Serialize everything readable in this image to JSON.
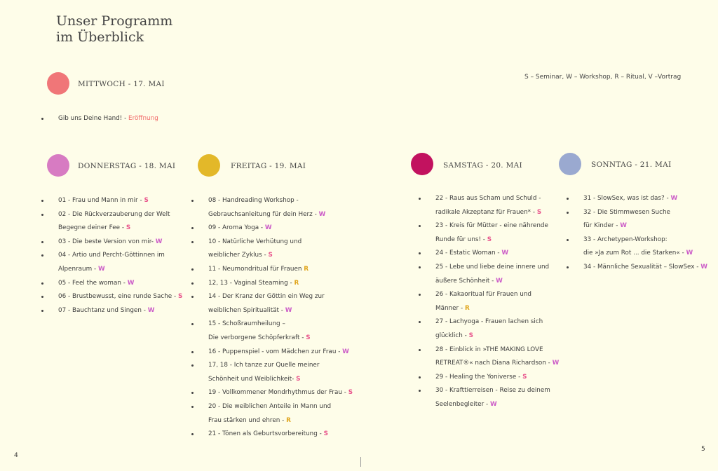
{
  "title": {
    "line1": "Unser Programm",
    "line2": "im Überblick"
  },
  "legend": "S – Seminar, W – Workshop, R – Ritual, V –Vortrag",
  "colors": {
    "S": "#e8518a",
    "W": "#cc5cc8",
    "R": "#e0a51d",
    "Eroeffnung": "#f26b6b"
  },
  "days": [
    {
      "label": "MITTWOCH - 17. MAI",
      "color": "#f07678"
    },
    {
      "label": "DONNERSTAG - 18. MAI",
      "color": "#d77bc2"
    },
    {
      "label": "FREITAG - 19. MAI",
      "color": "#e3b829"
    },
    {
      "label": "SAMSTAG - 20. MAI",
      "color": "#c2125f"
    },
    {
      "label": "SONNTAG - 21. MAI",
      "color": "#9aa9d0"
    }
  ],
  "mittwoch": [
    {
      "lines": [
        {
          "t": "Gib uns Deine Hand! - ",
          "c": "Eröffnung"
        }
      ]
    }
  ],
  "donnerstag": [
    {
      "lines": [
        {
          "t": "01 - Frau und Mann in mir - ",
          "c": "S"
        }
      ]
    },
    {
      "lines": [
        {
          "t": "02 - Die Rückverzauberung der Welt"
        },
        {
          "t": "Begegne deiner Fee - ",
          "c": "S"
        }
      ]
    },
    {
      "lines": [
        {
          "t": "03 - Die beste Version von mir- ",
          "c": "W"
        }
      ]
    },
    {
      "lines": [
        {
          "t": "04 - Artio und Percht-Göttinnen im"
        },
        {
          "t": "Alpenraum - ",
          "c": "W"
        }
      ]
    },
    {
      "lines": [
        {
          "t": "05 - Feel the woman - ",
          "c": "W"
        }
      ]
    },
    {
      "lines": [
        {
          "t": "06 - Brustbewusst, eine runde Sache - ",
          "c": "S"
        }
      ]
    },
    {
      "lines": [
        {
          "t": "07 - Bauchtanz und Singen - ",
          "c": "W"
        }
      ]
    }
  ],
  "freitag": [
    {
      "lines": [
        {
          "t": "08 - Handreading Workshop -"
        },
        {
          "t": "Gebrauchsanleitung für dein Herz - ",
          "c": "W"
        }
      ]
    },
    {
      "lines": [
        {
          "t": "09 - Aroma Yoga - ",
          "c": "W"
        }
      ]
    },
    {
      "lines": [
        {
          "t": "10 - Natürliche Verhütung und"
        },
        {
          "t": "weiblicher Zyklus - ",
          "c": "S"
        }
      ]
    },
    {
      "lines": [
        {
          "t": "11 - Neumondritual für Frauen ",
          "c": "R"
        }
      ]
    },
    {
      "lines": [
        {
          "t": "12, 13 - Vaginal Steaming - ",
          "c": "R"
        }
      ]
    },
    {
      "lines": [
        {
          "t": "14 - Der Kranz der Göttin ein Weg zur"
        },
        {
          "t": "weiblichen Spiritualität - ",
          "c": "W"
        }
      ]
    },
    {
      "lines": [
        {
          "t": "15 - Schoßraumheilung –"
        },
        {
          "t": "Die verborgene Schöpferkraft - ",
          "c": "S"
        }
      ]
    },
    {
      "lines": [
        {
          "t": "16 - Puppenspiel - vom Mädchen zur Frau - ",
          "c": "W"
        }
      ]
    },
    {
      "lines": [
        {
          "t": "17, 18 - Ich tanze zur Quelle meiner"
        },
        {
          "t": "Schönheit und Weiblichkeit- ",
          "c": "S"
        }
      ]
    },
    {
      "lines": [
        {
          "t": "19 - Vollkommener Mondrhythmus der Frau - ",
          "c": "S"
        }
      ]
    },
    {
      "lines": [
        {
          "t": "20 - Die weiblichen Anteile in Mann und"
        },
        {
          "t": "Frau stärken und ehren - ",
          "c": "R"
        }
      ]
    },
    {
      "lines": [
        {
          "t": "21 - Tönen als Geburtsvorbereitung - ",
          "c": "S"
        }
      ]
    }
  ],
  "samstag": [
    {
      "lines": [
        {
          "t": "22 - Raus aus Scham und Schuld -"
        },
        {
          "t": "radikale Akzeptanz für Frauen* - ",
          "c": "S"
        }
      ]
    },
    {
      "lines": [
        {
          "t": "23 - Kreis für Mütter - eine nährende"
        },
        {
          "t": "Runde für uns! - ",
          "c": "S"
        }
      ]
    },
    {
      "lines": [
        {
          "t": "24 - Estatic Woman - ",
          "c": "W"
        }
      ]
    },
    {
      "lines": [
        {
          "t": "25 - Lebe und liebe deine innere und"
        },
        {
          "t": "äußere Schönheit - ",
          "c": "W"
        }
      ]
    },
    {
      "lines": [
        {
          "t": "26 - Kakaoritual für Frauen und"
        },
        {
          "t": "Männer - ",
          "c": "R"
        }
      ]
    },
    {
      "lines": [
        {
          "t": "27 - Lachyoga - Frauen lachen sich"
        },
        {
          "t": "glücklich - ",
          "c": "S"
        }
      ]
    },
    {
      "lines": [
        {
          "t": "28 - Einblick in »THE MAKING LOVE"
        },
        {
          "t": "RETREAT®« nach Diana Richardson - ",
          "c": "W"
        }
      ]
    },
    {
      "lines": [
        {
          "t": "29 - Healing the Yoniverse - ",
          "c": "S"
        }
      ]
    },
    {
      "lines": [
        {
          "t": "30 - Krafttierreisen - Reise zu deinem"
        },
        {
          "t": "Seelenbegleiter - ",
          "c": "W"
        }
      ]
    }
  ],
  "sonntag": [
    {
      "lines": [
        {
          "t": "31 - SlowSex, was ist das? - ",
          "c": "W"
        }
      ]
    },
    {
      "lines": [
        {
          "t": "32 - Die Stimmwesen Suche"
        },
        {
          "t": "für Kinder - ",
          "c": "W"
        }
      ]
    },
    {
      "lines": [
        {
          "t": "33 - Archetypen-Workshop:"
        },
        {
          "t": "die »Ja zum Rot ... die Starken« - ",
          "c": "W"
        }
      ]
    },
    {
      "lines": [
        {
          "t": "34 - Männliche Sexualität – SlowSex - ",
          "c": "W"
        }
      ]
    }
  ],
  "page": {
    "left": "4",
    "right": "5"
  }
}
